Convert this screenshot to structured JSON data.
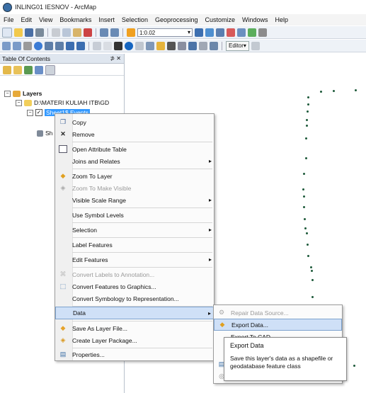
{
  "window": {
    "title": "INLING01 IESNOV - ArcMap"
  },
  "menubar": [
    "File",
    "Edit",
    "View",
    "Bookmarks",
    "Insert",
    "Selection",
    "Geoprocessing",
    "Customize",
    "Windows",
    "Help"
  ],
  "toolbar": {
    "scale_value": "1:0.02",
    "editor_label": "Editor▾"
  },
  "toc": {
    "title": "Table Of Contents",
    "controls": "⊅ ✕",
    "layers_label": "Layers",
    "folder_label": "D:\\MATERI KULIAH ITB\\GD",
    "layer_label": "Sheet1$ Events",
    "layer2_label": "Sh"
  },
  "context_menu": {
    "items": [
      {
        "label": "Copy",
        "icon": "copy-icon",
        "enabled": true,
        "submenu": false
      },
      {
        "label": "Remove",
        "icon": "remove-icon",
        "enabled": true,
        "submenu": false
      },
      {
        "label": "Open Attribute Table",
        "icon": "table-icon",
        "enabled": true,
        "submenu": false
      },
      {
        "label": "Joins and Relates",
        "icon": "",
        "enabled": true,
        "submenu": true
      },
      {
        "label": "Zoom To Layer",
        "icon": "zoom-layer-icon",
        "enabled": true,
        "submenu": false
      },
      {
        "label": "Zoom To Make Visible",
        "icon": "zoom-visible-icon",
        "enabled": false,
        "submenu": false
      },
      {
        "label": "Visible Scale Range",
        "icon": "",
        "enabled": true,
        "submenu": true
      },
      {
        "label": "Use Symbol Levels",
        "icon": "",
        "enabled": true,
        "submenu": false
      },
      {
        "label": "Selection",
        "icon": "",
        "enabled": true,
        "submenu": true
      },
      {
        "label": "Label Features",
        "icon": "",
        "enabled": true,
        "submenu": false
      },
      {
        "label": "Edit Features",
        "icon": "",
        "enabled": true,
        "submenu": true
      },
      {
        "label": "Convert Labels to Annotation...",
        "icon": "annotation-icon",
        "enabled": false,
        "submenu": false
      },
      {
        "label": "Convert Features to Graphics...",
        "icon": "graphics-icon",
        "enabled": true,
        "submenu": false
      },
      {
        "label": "Convert Symbology to Representation...",
        "icon": "",
        "enabled": true,
        "submenu": false
      },
      {
        "label": "Data",
        "icon": "",
        "enabled": true,
        "submenu": true
      },
      {
        "label": "Save As Layer File...",
        "icon": "layer-file-icon",
        "enabled": true,
        "submenu": false
      },
      {
        "label": "Create Layer Package...",
        "icon": "layer-package-icon",
        "enabled": true,
        "submenu": false
      },
      {
        "label": "Properties...",
        "icon": "properties-icon",
        "enabled": true,
        "submenu": false
      }
    ]
  },
  "submenu": {
    "items": [
      {
        "label": "Repair Data Source...",
        "enabled": false
      },
      {
        "label": "Export Data...",
        "enabled": true
      },
      {
        "label": "Export To CAD",
        "enabled": true
      }
    ]
  },
  "tooltip": {
    "title": "Export Data",
    "text": "Save this layer's data as a shapefile or geodatabase feature class"
  },
  "colors": {
    "accent": "#3399ff",
    "map_point": "#1d5a3a"
  }
}
